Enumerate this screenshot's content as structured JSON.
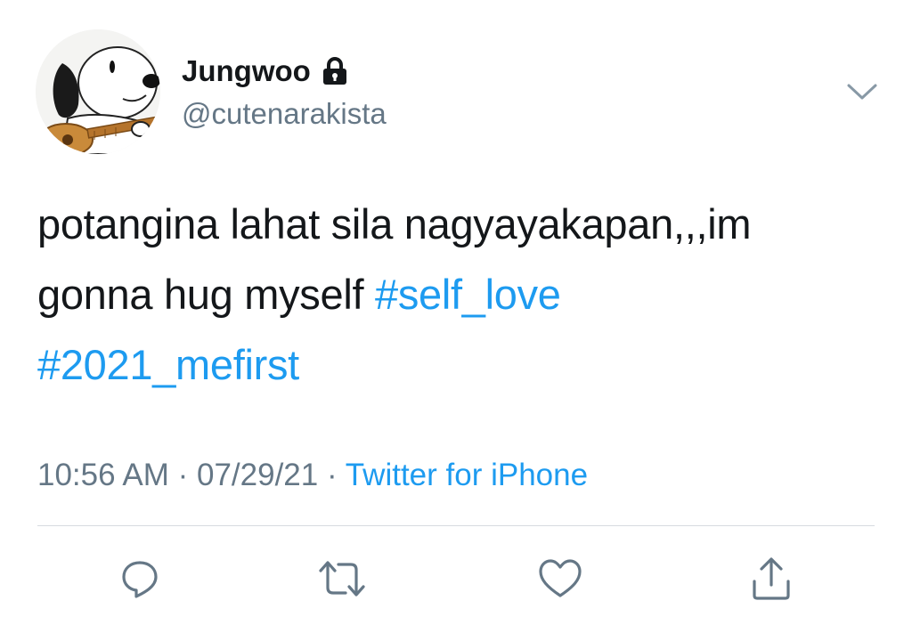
{
  "user": {
    "display_name": "Jungwoo",
    "handle": "@cutenarakista",
    "avatar_icon": "snoopy-avatar-icon",
    "protected_icon": "lock-icon"
  },
  "tweet": {
    "text_lines": [
      [
        {
          "text": "potangina lahat sila nagyayakapan,,,im",
          "type": "text"
        }
      ],
      [
        {
          "text": "gonna hug myself ",
          "type": "text"
        },
        {
          "text": "#self_love",
          "type": "hashtag"
        }
      ],
      [
        {
          "text": "#2021_mefirst",
          "type": "hashtag"
        }
      ]
    ],
    "time": "10:56 AM",
    "separator": " · ",
    "date": "07/29/21",
    "source": "Twitter for iPhone"
  },
  "actions": {
    "reply_icon": "reply-icon",
    "retweet_icon": "retweet-icon",
    "like_icon": "heart-icon",
    "share_icon": "share-icon"
  },
  "colors": {
    "hashtag": "#1d9bf0",
    "secondary_text": "#657786",
    "primary_text": "#14171a"
  }
}
